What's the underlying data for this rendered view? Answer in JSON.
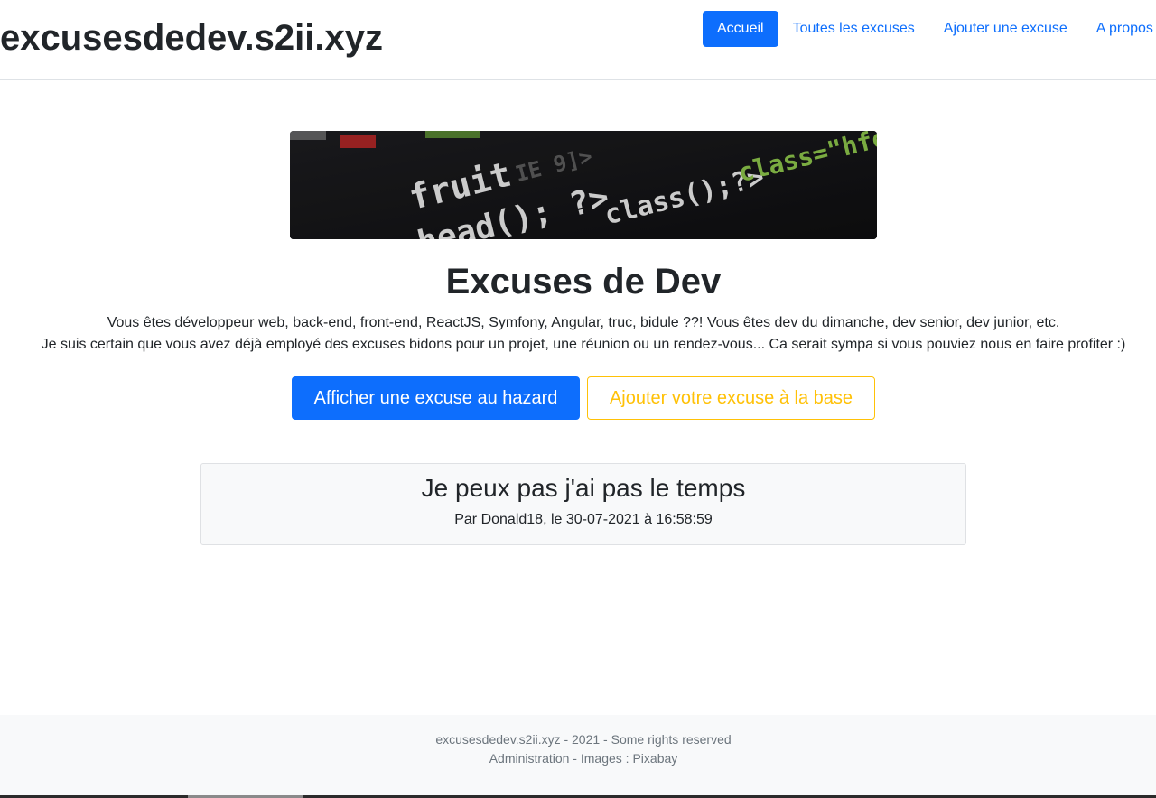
{
  "header": {
    "brand": "excusesdedev.s2ii.xyz",
    "nav": [
      {
        "label": "Accueil",
        "active": true
      },
      {
        "label": "Toutes les excuses",
        "active": false
      },
      {
        "label": "Ajouter une excuse",
        "active": false
      },
      {
        "label": "A propos",
        "active": false
      }
    ]
  },
  "hero": {
    "image_icon": "code-banner-image",
    "image_code": [
      "fruit",
      "IE 9]>",
      "php head(); ?>",
      "class();?>",
      "class=\"hfe"
    ],
    "title": "Excuses de Dev",
    "intro_line1": "Vous êtes développeur web, back-end, front-end, ReactJS, Symfony, Angular, truc, bidule ??! Vous êtes dev du dimanche, dev senior, dev junior, etc.",
    "intro_line2": "Je suis certain que vous avez déjà employé des excuses bidons pour un projet, une réunion ou un rendez-vous... Ca serait sympa si vous pouviez nous en faire profiter :)",
    "random_button": "Afficher une excuse au hazard",
    "add_button": "Ajouter votre excuse à la base"
  },
  "excuse": {
    "text": "Je peux pas j'ai pas le temps",
    "meta": "Par Donald18, le 30-07-2021 à 16:58:59"
  },
  "footer": {
    "line1": "excusesdedev.s2ii.xyz - 2021 - Some rights reserved",
    "admin_link": "Administration",
    "separator": " - Images : ",
    "pixabay_link": "Pixabay"
  },
  "colors": {
    "primary": "#0d6efd",
    "warning": "#ffc107",
    "muted": "#6c757d",
    "light": "#f8f9fa"
  }
}
